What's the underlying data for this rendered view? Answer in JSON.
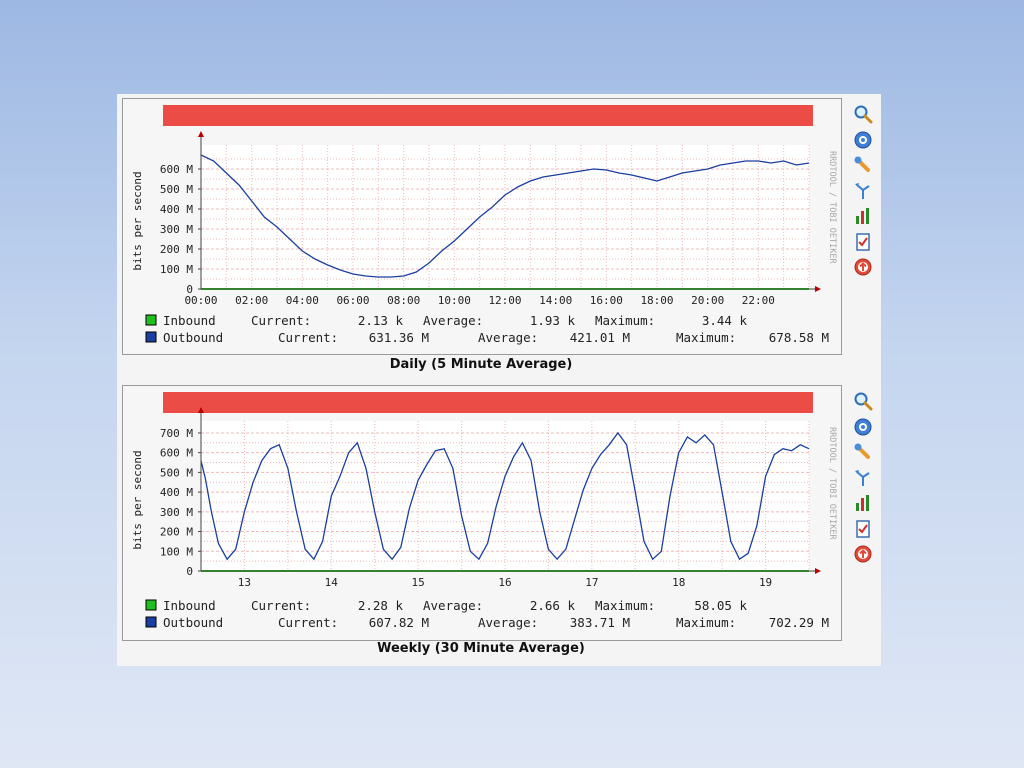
{
  "colors": {
    "title_bar": "#ec4c46",
    "outbound": "#1a3fa0",
    "inbound": "#1fbf1f",
    "grid": "#f3b8b8",
    "axis": "#444444",
    "arrow": "#b80000"
  },
  "icons": [
    "magnifier-icon",
    "info-icon",
    "wrench-icon",
    "branch-icon",
    "bar-chart-icon",
    "checklist-icon",
    "upload-icon"
  ],
  "graphs": [
    {
      "id": "daily",
      "caption": "Daily (5 Minute Average)",
      "watermark": "RRDTOOL / TOBI OETIKER",
      "legend": {
        "inbound_label": "Inbound",
        "outbound_label": "Outbound",
        "inbound": {
          "current_label": "Current:",
          "current": "2.13 k",
          "average_label": "Average:",
          "average": "1.93 k",
          "maximum_label": "Maximum:",
          "maximum": "3.44 k"
        },
        "outbound": {
          "current_label": "Current:",
          "current": "631.36 M",
          "average_label": "Average:",
          "average": "421.01 M",
          "maximum_label": "Maximum:",
          "maximum": "678.58 M"
        }
      }
    },
    {
      "id": "weekly",
      "caption": "Weekly (30 Minute Average)",
      "watermark": "RRDTOOL / TOBI OETIKER",
      "legend": {
        "inbound_label": "Inbound",
        "outbound_label": "Outbound",
        "inbound": {
          "current_label": "Current:",
          "current": "2.28 k",
          "average_label": "Average:",
          "average": "2.66 k",
          "maximum_label": "Maximum:",
          "maximum": "58.05 k"
        },
        "outbound": {
          "current_label": "Current:",
          "current": "607.82 M",
          "average_label": "Average:",
          "average": "383.71 M",
          "maximum_label": "Maximum:",
          "maximum": "702.29 M"
        }
      }
    }
  ],
  "chart_data": [
    {
      "type": "line",
      "title": "",
      "ylabel": "bits per second",
      "xlabel": "",
      "y_unit": "M",
      "ylim": [
        0,
        680
      ],
      "yticks": [
        0,
        100,
        200,
        300,
        400,
        500,
        600
      ],
      "ytick_labels": [
        "0",
        "100 M",
        "200 M",
        "300 M",
        "400 M",
        "500 M",
        "600 M"
      ],
      "xlim": [
        0,
        24
      ],
      "xticks": [
        0,
        2,
        4,
        6,
        8,
        10,
        12,
        14,
        16,
        18,
        20,
        22
      ],
      "xtick_labels": [
        "00:00",
        "02:00",
        "04:00",
        "06:00",
        "08:00",
        "10:00",
        "12:00",
        "14:00",
        "16:00",
        "18:00",
        "20:00",
        "22:00"
      ],
      "grid": true,
      "series": [
        {
          "name": "Outbound",
          "x": [
            0,
            0.5,
            1,
            1.5,
            2,
            2.5,
            3,
            3.5,
            4,
            4.5,
            5,
            5.5,
            6,
            6.5,
            7,
            7.5,
            8,
            8.5,
            9,
            9.5,
            10,
            10.5,
            11,
            11.5,
            12,
            12.5,
            13,
            13.5,
            14,
            14.5,
            15,
            15.5,
            16,
            16.5,
            17,
            17.5,
            18,
            18.5,
            19,
            19.5,
            20,
            20.5,
            21,
            21.5,
            22,
            22.5,
            23,
            23.5,
            24
          ],
          "y": [
            670,
            640,
            580,
            520,
            440,
            360,
            310,
            250,
            190,
            150,
            120,
            95,
            75,
            65,
            60,
            60,
            65,
            85,
            130,
            190,
            240,
            300,
            360,
            410,
            470,
            510,
            540,
            560,
            570,
            580,
            590,
            600,
            595,
            580,
            570,
            555,
            540,
            560,
            580,
            590,
            600,
            620,
            630,
            640,
            640,
            630,
            640,
            620,
            630
          ]
        },
        {
          "name": "Inbound",
          "x": [
            0,
            24
          ],
          "y": [
            0.002,
            0.002
          ]
        }
      ]
    },
    {
      "type": "line",
      "title": "",
      "ylabel": "bits per second",
      "xlabel": "",
      "y_unit": "M",
      "ylim": [
        0,
        720
      ],
      "yticks": [
        0,
        100,
        200,
        300,
        400,
        500,
        600,
        700
      ],
      "ytick_labels": [
        "0",
        "100 M",
        "200 M",
        "300 M",
        "400 M",
        "500 M",
        "600 M",
        "700 M"
      ],
      "xlim": [
        12.5,
        19.5
      ],
      "xticks": [
        13,
        14,
        15,
        16,
        17,
        18,
        19
      ],
      "xtick_labels": [
        "13",
        "14",
        "15",
        "16",
        "17",
        "18",
        "19"
      ],
      "grid": true,
      "series": [
        {
          "name": "Outbound",
          "x": [
            12.5,
            12.55,
            12.62,
            12.7,
            12.8,
            12.9,
            13.0,
            13.1,
            13.2,
            13.3,
            13.4,
            13.5,
            13.6,
            13.7,
            13.8,
            13.9,
            14.0,
            14.1,
            14.2,
            14.3,
            14.4,
            14.5,
            14.6,
            14.7,
            14.8,
            14.9,
            15.0,
            15.1,
            15.2,
            15.3,
            15.4,
            15.5,
            15.6,
            15.7,
            15.8,
            15.9,
            16.0,
            16.1,
            16.2,
            16.3,
            16.4,
            16.5,
            16.6,
            16.7,
            16.8,
            16.9,
            17.0,
            17.1,
            17.2,
            17.3,
            17.4,
            17.5,
            17.6,
            17.7,
            17.8,
            17.9,
            18.0,
            18.1,
            18.2,
            18.3,
            18.4,
            18.5,
            18.6,
            18.7,
            18.8,
            18.9,
            19.0,
            19.1,
            19.2,
            19.3,
            19.4,
            19.5
          ],
          "y": [
            560,
            470,
            300,
            140,
            60,
            110,
            300,
            450,
            560,
            620,
            640,
            520,
            300,
            110,
            60,
            150,
            380,
            480,
            600,
            650,
            520,
            300,
            110,
            60,
            120,
            320,
            460,
            540,
            610,
            620,
            520,
            280,
            100,
            60,
            140,
            330,
            480,
            580,
            650,
            560,
            300,
            110,
            60,
            110,
            260,
            410,
            520,
            590,
            640,
            700,
            640,
            400,
            150,
            60,
            100,
            380,
            600,
            680,
            650,
            690,
            640,
            400,
            150,
            60,
            90,
            230,
            480,
            590,
            620,
            610,
            640,
            620
          ]
        },
        {
          "name": "Inbound",
          "x": [
            12.5,
            19.5
          ],
          "y": [
            0.003,
            0.003
          ]
        }
      ]
    }
  ]
}
